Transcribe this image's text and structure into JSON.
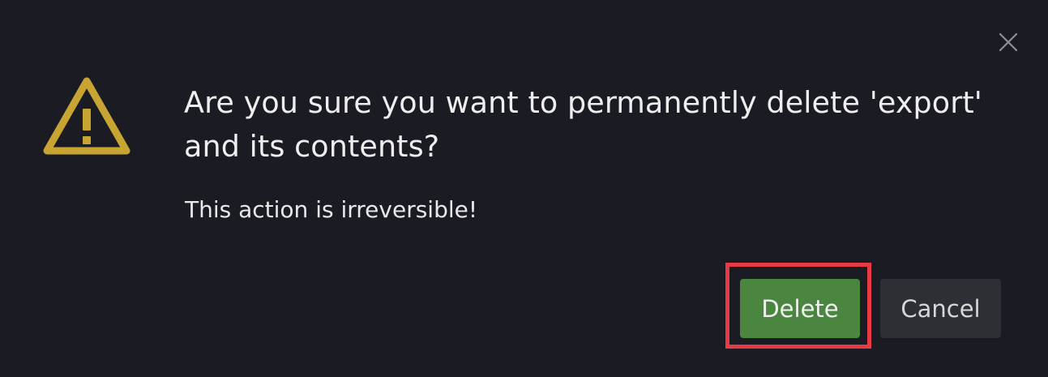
{
  "dialog": {
    "close_icon": "close-x-icon",
    "warning_icon": "warning-triangle-icon",
    "title": "Are you sure you want to permanently delete 'export' and its contents?",
    "message": "This action is irreversible!",
    "buttons": {
      "delete_label": "Delete",
      "cancel_label": "Cancel"
    }
  },
  "colors": {
    "background": "#1b1c23",
    "warning": "#c8a533",
    "delete_button": "#4b8640",
    "cancel_button": "#2d2f35",
    "highlight": "#e83a45"
  }
}
